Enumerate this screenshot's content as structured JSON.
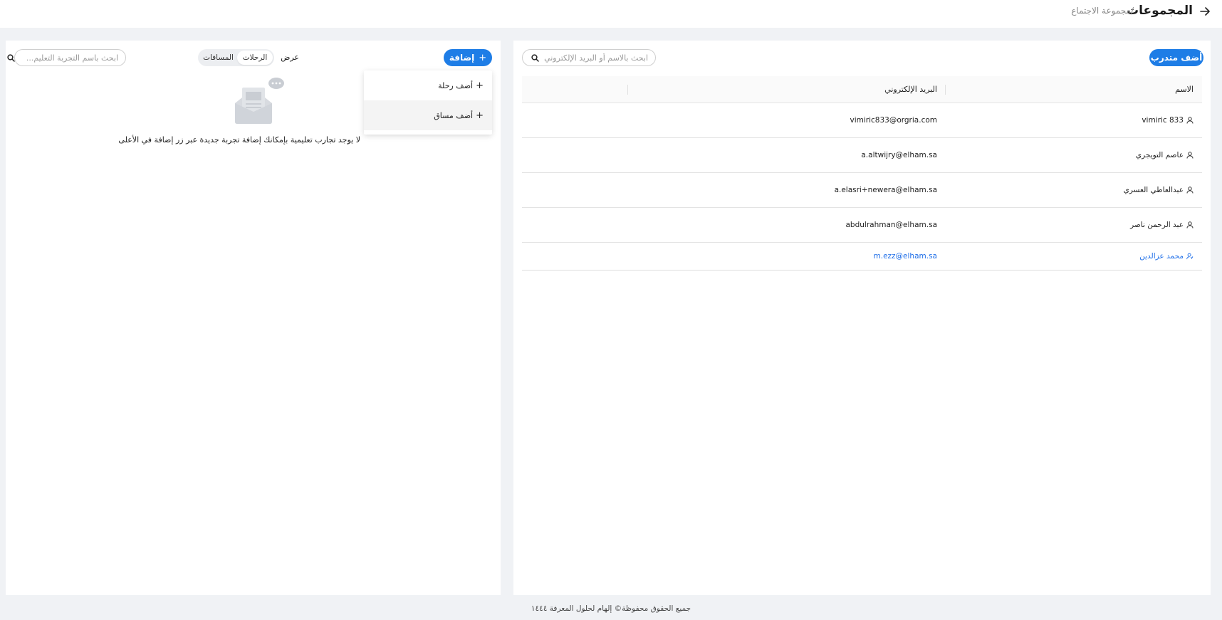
{
  "header": {
    "title": "المجموعات",
    "breadcrumb": "/مجموعة الاجتماع",
    "back_icon": "arrow-right-icon"
  },
  "trainees": {
    "add_button_label": "أضف متدرب",
    "search_placeholder": "ابحث بالاسم أو البريد الإلكتروني",
    "columns": {
      "name": "الاسم",
      "email": "البريد الإلكتروني"
    },
    "rows": [
      {
        "name": "vimiric 833",
        "email": "vimiric833@orgria.com"
      },
      {
        "name": "عاصم التويجري",
        "email": "a.altwijry@elham.sa"
      },
      {
        "name": "عبدالعاطي العسري",
        "email": "a.elasri+newera@elham.sa"
      },
      {
        "name": "عبد الرحمن ناصر",
        "email": "abdulrahman@elham.sa"
      },
      {
        "name": "محمد عزالدين",
        "email": "m.ezz@elham.sa"
      }
    ]
  },
  "experiences": {
    "add_button_label": "إضافة",
    "view_label": "عرض",
    "segments": [
      "الرحلات",
      "المسافات"
    ],
    "search_placeholder": "ابحث باسم التجربة التعليم...",
    "dropdown": [
      "أضف رحلة",
      "أضف مساق"
    ],
    "empty_message": "لا يوجد تجارب تعليمية بإمكانك إضافة تجربة جديدة عبر زر إضافة في الأعلى"
  },
  "footer": {
    "text": "جميع الحقوق محفوظة© إلهام لحلول المعرفة ١٤٤٤"
  },
  "colors": {
    "primary": "#1e7de6",
    "link": "#1e6ee8",
    "background": "#f0f2f5"
  }
}
